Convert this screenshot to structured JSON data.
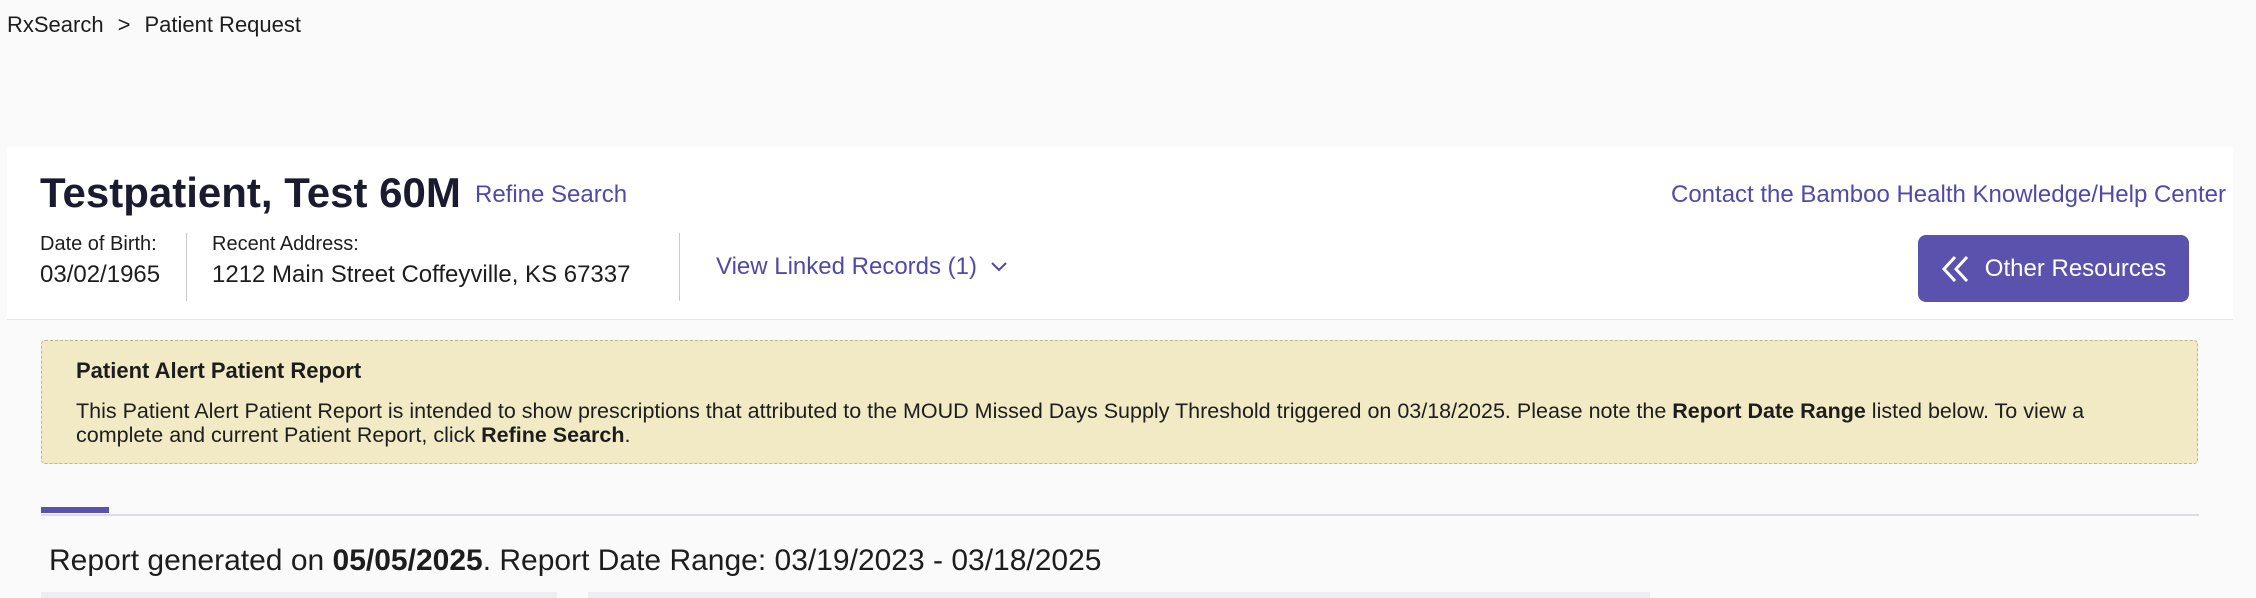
{
  "breadcrumb": {
    "root": "RxSearch",
    "separator": ">",
    "current": "Patient Request"
  },
  "patient": {
    "name": "Testpatient, Test 60M",
    "refine_label": "Refine Search",
    "help_link": "Contact the Bamboo Health Knowledge/Help Center",
    "dob_label": "Date of Birth:",
    "dob_value": "03/02/1965",
    "address_label": "Recent Address:",
    "address_value": "1212 Main Street Coffeyville, KS 67337",
    "linked_records_label": "View Linked Records (1)",
    "resources_label": "Other Resources"
  },
  "alert": {
    "title": "Patient Alert Patient Report",
    "body_1": "This Patient Alert Patient Report is intended to show prescriptions that attributed to the MOUD Missed Days Supply Threshold triggered on 03/18/2025. Please note the ",
    "body_bold_1": "Report Date Range",
    "body_2": " listed below. To view a complete and current Patient Report, click ",
    "body_bold_2": "Refine Search",
    "body_3": "."
  },
  "report": {
    "prefix": "Report generated on ",
    "generated_date": "05/05/2025",
    "range_text": ". Report Date Range: 03/19/2023 - 03/18/2025"
  },
  "colors": {
    "accent": "#5a52ad",
    "link": "#4f4aa8",
    "alert_bg": "#f1eac5"
  },
  "icons": {
    "linked_records": "chevron-down-icon",
    "resources": "double-chevron-left-icon"
  }
}
